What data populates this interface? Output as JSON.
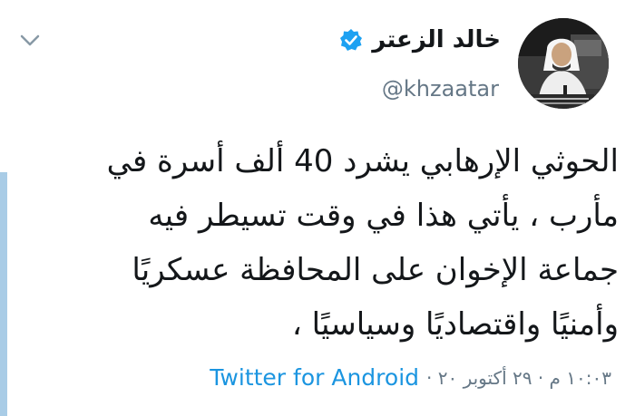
{
  "author": {
    "display_name": "خالد الزعتر",
    "handle": "@khzaatar",
    "verified": true
  },
  "tweet": {
    "lines": [
      "الحوثي الإرهابي يشرد 40 ألف أسرة في",
      "مأرب ، يأتي هذا في وقت تسيطر فيه",
      "جماعة الإخوان على المحافظة عسكريًا",
      "وأمنيًا واقتصاديًا وسياسيًا ،"
    ]
  },
  "meta": {
    "source": "Twitter for Android",
    "timestamp": "١٠:٠٣ م · ٢٩ أكتوبر ٢٠ ·"
  },
  "icons": {
    "menu": "chevron-down-icon",
    "verified": "verified-badge-icon"
  },
  "colors": {
    "link": "#1b95e0",
    "text": "#14171a",
    "secondary": "#657786",
    "thread_bar": "#a9cce6",
    "verified": "#1da1f2"
  }
}
